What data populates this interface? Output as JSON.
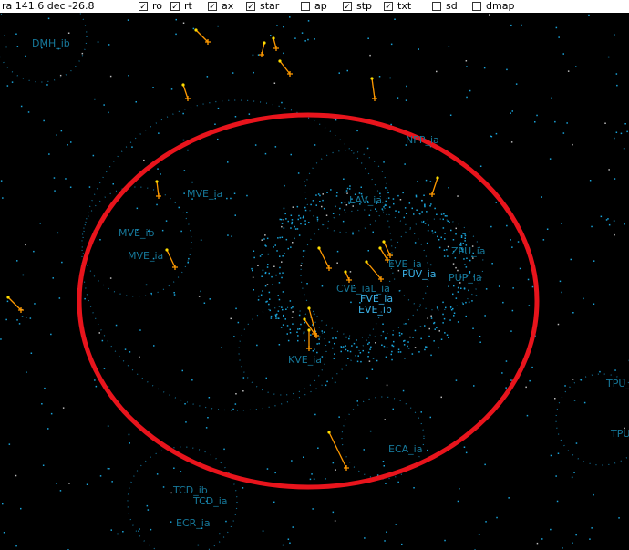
{
  "toolbar": {
    "coords": "ra 141.6 dec -26.8",
    "options": [
      {
        "label": "ro",
        "checked": true
      },
      {
        "label": "rt",
        "checked": true
      },
      {
        "label": "ax",
        "checked": true
      },
      {
        "label": "star",
        "checked": true
      },
      {
        "label": "ap",
        "checked": false
      },
      {
        "label": "stp",
        "checked": true
      },
      {
        "label": "txt",
        "checked": true
      },
      {
        "label": "sd",
        "checked": false
      },
      {
        "label": "dmap",
        "checked": false
      }
    ]
  },
  "labels": [
    "DMH_ib",
    "NPP_ia",
    "MVE_ia",
    "LAV_ia",
    "MVE_ib",
    "MVE_ia",
    "ZPU_ia",
    "EVE_ia",
    "PUV_ia",
    "PUP_ia",
    "CVE_iaL_ia",
    "FVE_ia",
    "EVE_ib",
    "KVE_ia",
    "TPU_",
    "TPU_",
    "ECA_ia",
    "TCD_ib",
    "TCD_ia",
    "ECR_ia"
  ],
  "colors": {
    "background": "#000000",
    "stars": "#1aa3d9",
    "vectors": "#ff9900",
    "vector_start": "#ffdd00",
    "highlight_ellipse": "#e8141c",
    "labels": "#16789a"
  }
}
